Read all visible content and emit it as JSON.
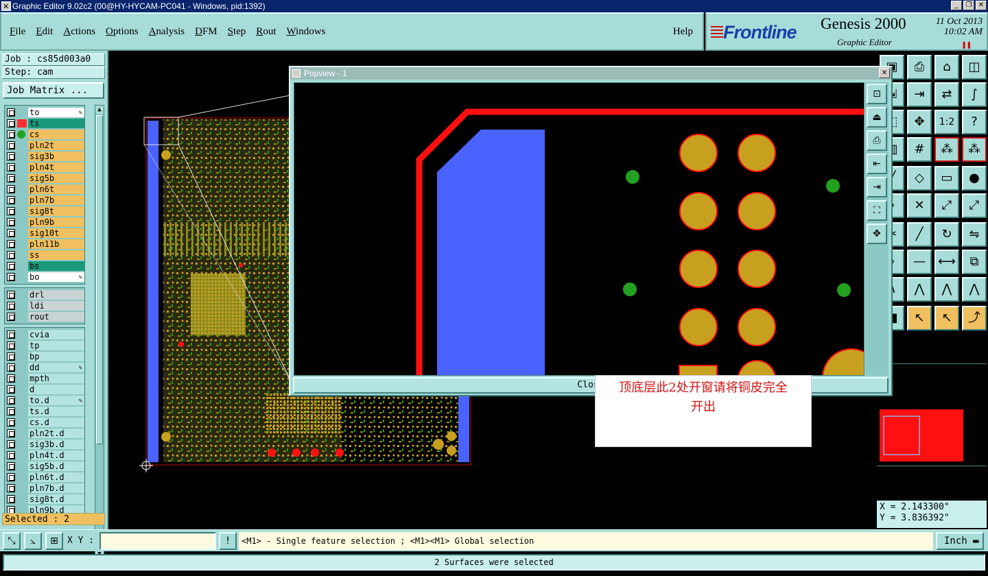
{
  "window": {
    "title": "Graphic Editor 9.02c2 (00@HY-HYCAM-PC041 - Windows, pid:1392)"
  },
  "menu": {
    "items": [
      "File",
      "Edit",
      "Actions",
      "Options",
      "Analysis",
      "DFM",
      "Step",
      "Rout",
      "Windows"
    ],
    "help": "Help"
  },
  "brand": {
    "logo": "Frontline",
    "product": "Genesis 2000",
    "subtitle": "Graphic Editor",
    "date": "11 Oct 2013",
    "time": "10:02 AM"
  },
  "job": {
    "job_label": "Job : cs85d003a0",
    "step_label": "Step: cam",
    "matrix_button": "Job Matrix ...",
    "selected": "Selected : 2"
  },
  "layers": {
    "board": [
      {
        "name": "to",
        "color": "#ffffff",
        "mark": "none",
        "edit": true
      },
      {
        "name": "ts",
        "color": "#1a9a7a",
        "mark": "work",
        "edit": false
      },
      {
        "name": "cs",
        "color": "#f0c060",
        "mark": "display",
        "edit": false
      },
      {
        "name": "pln2t",
        "color": "#f0c060",
        "mark": "none",
        "edit": false
      },
      {
        "name": "sig3b",
        "color": "#f0c060",
        "mark": "none",
        "edit": false
      },
      {
        "name": "pln4t",
        "color": "#f0c060",
        "mark": "none",
        "edit": false
      },
      {
        "name": "sig5b",
        "color": "#f0c060",
        "mark": "none",
        "edit": false
      },
      {
        "name": "pln6t",
        "color": "#f0c060",
        "mark": "none",
        "edit": false
      },
      {
        "name": "pln7b",
        "color": "#f0c060",
        "mark": "none",
        "edit": false
      },
      {
        "name": "sig8t",
        "color": "#f0c060",
        "mark": "none",
        "edit": false
      },
      {
        "name": "pln9b",
        "color": "#f0c060",
        "mark": "none",
        "edit": false
      },
      {
        "name": "sig10t",
        "color": "#f0c060",
        "mark": "none",
        "edit": false
      },
      {
        "name": "pln11b",
        "color": "#f0c060",
        "mark": "none",
        "edit": false
      },
      {
        "name": "ss",
        "color": "#f0c060",
        "mark": "none",
        "edit": false
      },
      {
        "name": "bs",
        "color": "#1a9a7a",
        "mark": "none",
        "edit": false
      },
      {
        "name": "bo",
        "color": "#ffffff",
        "mark": "none",
        "edit": true
      }
    ],
    "drill": [
      {
        "name": "drl",
        "color": "#c8d4d4",
        "edit": false
      },
      {
        "name": "ldi",
        "color": "#c8d4d4",
        "edit": false
      },
      {
        "name": "rout",
        "color": "#c8d4d4",
        "edit": false
      }
    ],
    "misc": [
      {
        "name": "cvia",
        "color": "#b4e4e0",
        "edit": false
      },
      {
        "name": "tp",
        "color": "#b4e4e0",
        "edit": false
      },
      {
        "name": "bp",
        "color": "#b4e4e0",
        "edit": false
      },
      {
        "name": "dd",
        "color": "#b4e4e0",
        "edit": true
      },
      {
        "name": "mpth",
        "color": "#b4e4e0",
        "edit": false
      },
      {
        "name": "d",
        "color": "#b4e4e0",
        "edit": false
      },
      {
        "name": "to.d",
        "color": "#b4e4e0",
        "edit": true
      },
      {
        "name": "ts.d",
        "color": "#b4e4e0",
        "edit": false
      },
      {
        "name": "cs.d",
        "color": "#b4e4e0",
        "edit": false
      },
      {
        "name": "pln2t.d",
        "color": "#b4e4e0",
        "edit": false
      },
      {
        "name": "sig3b.d",
        "color": "#b4e4e0",
        "edit": false
      },
      {
        "name": "pln4t.d",
        "color": "#b4e4e0",
        "edit": false
      },
      {
        "name": "sig5b.d",
        "color": "#b4e4e0",
        "edit": false
      },
      {
        "name": "pln6t.d",
        "color": "#b4e4e0",
        "edit": false
      },
      {
        "name": "pln7b.d",
        "color": "#b4e4e0",
        "edit": false
      },
      {
        "name": "sig8t.d",
        "color": "#b4e4e0",
        "edit": false
      },
      {
        "name": "pln9b.d",
        "color": "#b4e4e0",
        "edit": false
      }
    ]
  },
  "popview": {
    "title": "Popview - 1",
    "close_button": "Close"
  },
  "annotation": {
    "line1": "顶底层此2处开窗请将铜皮完全",
    "line2": "开出"
  },
  "coords": {
    "x": "X = 2.143300\"",
    "y": "Y = 3.836392\""
  },
  "command": {
    "xy_label": "X Y :",
    "xy_value": "",
    "hint": "<M1> - Single feature selection ; <M1><M1> Global selection",
    "units": "Inch"
  },
  "status": {
    "message": "2 Surfaces were selected"
  },
  "colors": {
    "panel": "#a8dcd8",
    "copper": "#c8a020",
    "mask_red": "#ff1010",
    "surface_blue": "#4a63ff",
    "via_green": "#22a020"
  }
}
